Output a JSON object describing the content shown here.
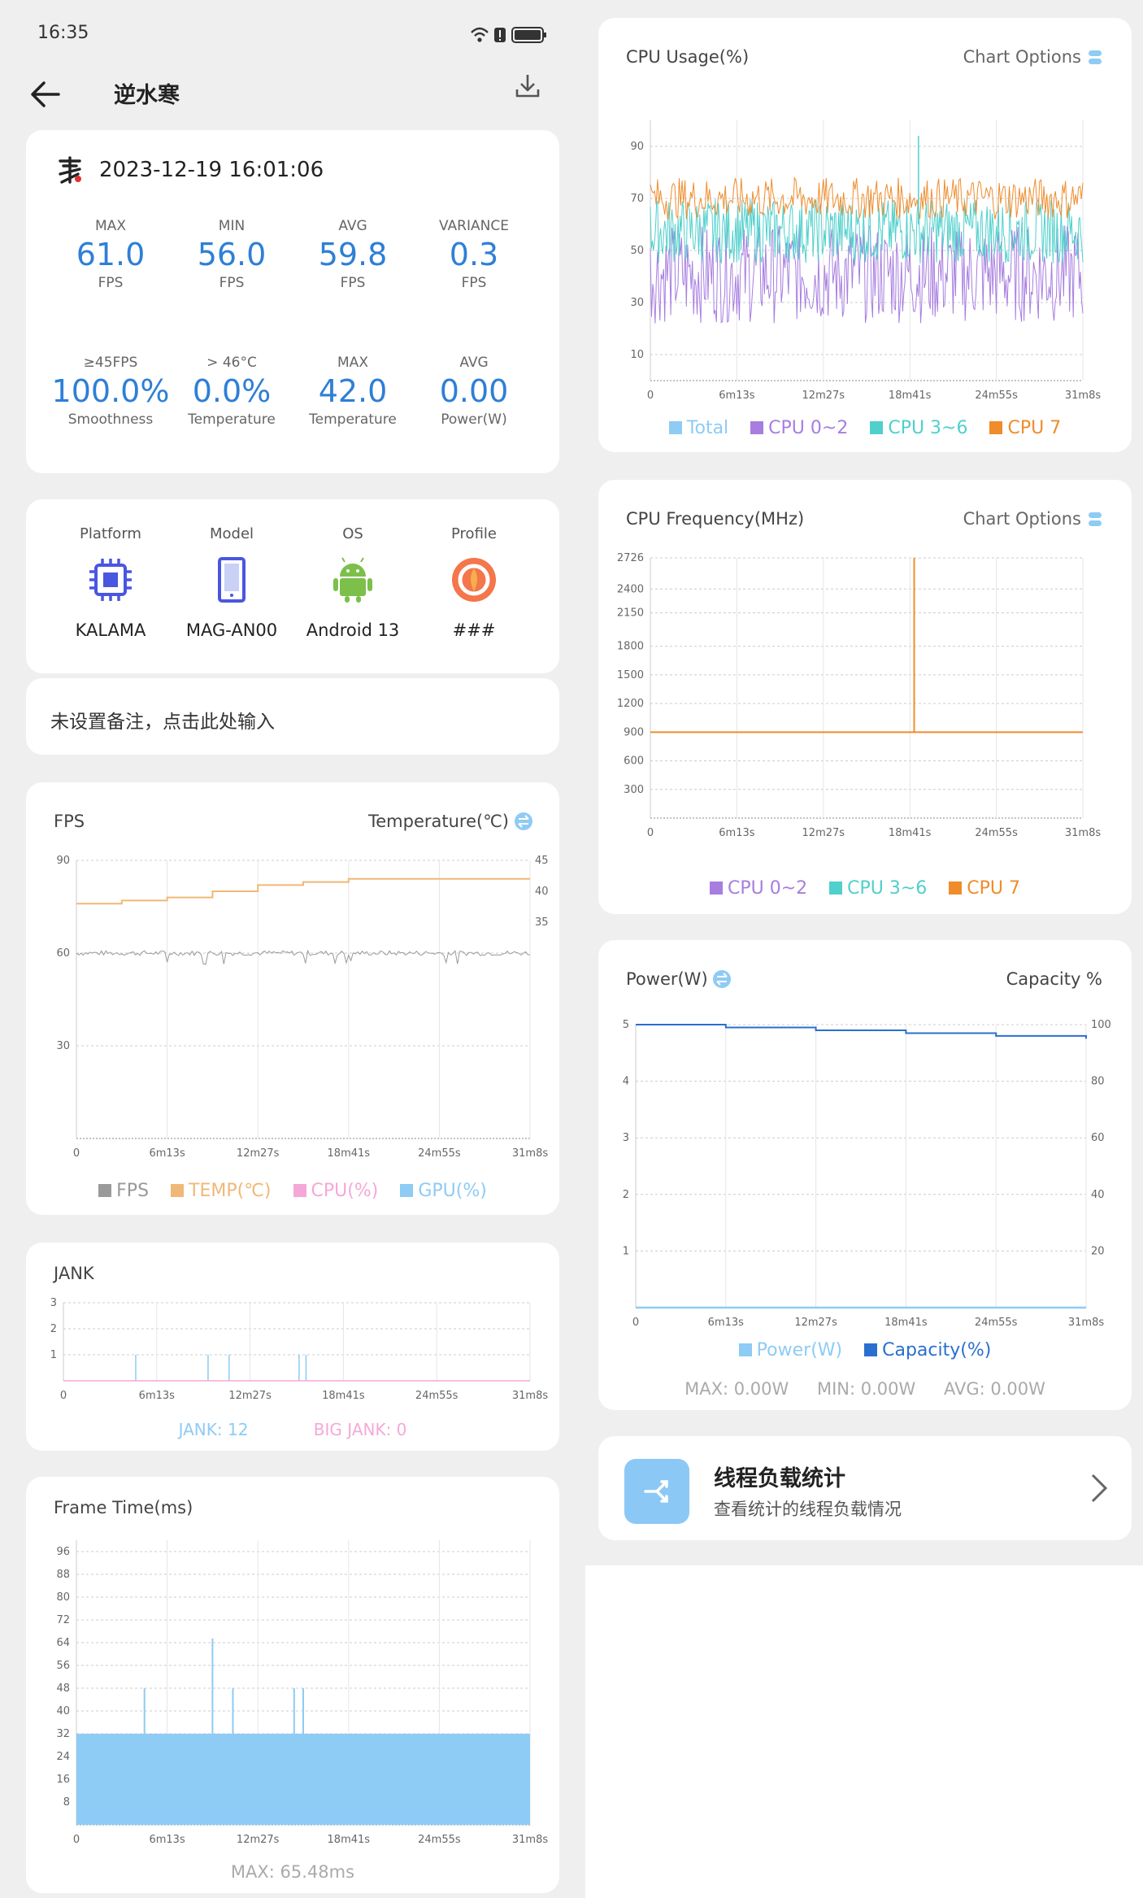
{
  "status": {
    "time": "16:35"
  },
  "header": {
    "title": "逆水寒"
  },
  "summary": {
    "datetime": "2023-12-19 16:01:06",
    "stats": [
      {
        "label": "MAX",
        "value": "61.0",
        "unit": "FPS"
      },
      {
        "label": "MIN",
        "value": "56.0",
        "unit": "FPS"
      },
      {
        "label": "AVG",
        "value": "59.8",
        "unit": "FPS"
      },
      {
        "label": "VARIANCE",
        "value": "0.3",
        "unit": "FPS"
      },
      {
        "label": "≥45FPS",
        "value": "100.0%",
        "unit": "Smoothness"
      },
      {
        "label": "> 46°C",
        "value": "0.0%",
        "unit": "Temperature"
      },
      {
        "label": "MAX",
        "value": "42.0",
        "unit": "Temperature"
      },
      {
        "label": "AVG",
        "value": "0.00",
        "unit": "Power(W)"
      }
    ]
  },
  "device": [
    {
      "label": "Platform",
      "value": "KALAMA",
      "icon": "chip-icon"
    },
    {
      "label": "Model",
      "value": "MAG-AN00",
      "icon": "phone-icon"
    },
    {
      "label": "OS",
      "value": "Android 13",
      "icon": "android-icon"
    },
    {
      "label": "Profile",
      "value": "###",
      "icon": "profile-icon"
    }
  ],
  "note": {
    "placeholder": "未设置备注，点击此处输入"
  },
  "fps_card": {
    "title": "FPS",
    "right": "Temperature(℃)",
    "legend": [
      "FPS",
      "TEMP(℃)",
      "CPU(%)",
      "GPU(%)"
    ]
  },
  "jank_card": {
    "title": "JANK",
    "jank": "JANK: 12",
    "big_jank": "BIG JANK: 0"
  },
  "frame_card": {
    "title": "Frame Time(ms)",
    "max": "MAX: 65.48ms"
  },
  "cpu_usage_card": {
    "title": "CPU Usage(%)",
    "options": "Chart Options",
    "legend": [
      "Total",
      "CPU 0~2",
      "CPU 3~6",
      "CPU 7"
    ]
  },
  "cpu_freq_card": {
    "title": "CPU Frequency(MHz)",
    "options": "Chart Options",
    "legend": [
      "CPU 0~2",
      "CPU 3~6",
      "CPU 7"
    ]
  },
  "power_card": {
    "title": "Power(W)",
    "right": "Capacity %",
    "legend": [
      "Power(W)",
      "Capacity(%)"
    ],
    "stats": [
      "MAX: 0.00W",
      "MIN: 0.00W",
      "AVG: 0.00W"
    ]
  },
  "thread_card": {
    "title": "线程负载统计",
    "subtitle": "查看统计的线程负载情况"
  },
  "colors": {
    "accent": "#2e7fd6",
    "fps": "#9a9a9a",
    "temp": "#f0b878",
    "cpu": "#f5a8d8",
    "gpu": "#8ecbf5",
    "total": "#8ecbf5",
    "cpu02": "#a77de0",
    "cpu36": "#4fd0cc",
    "cpu7": "#ef8c2c",
    "capacity": "#2a6fcf"
  },
  "chart_data": [
    {
      "type": "line",
      "title": "FPS",
      "x_ticks": [
        "0",
        "6m13s",
        "12m27s",
        "18m41s",
        "24m55s",
        "31m8s"
      ],
      "y_ticks": [
        "30",
        "60",
        "90"
      ],
      "y2_ticks": [
        "35",
        "40",
        "45"
      ],
      "ylim": [
        0,
        90
      ],
      "y2lim": [
        0,
        45
      ],
      "series": [
        {
          "name": "FPS",
          "approx_value": 60
        },
        {
          "name": "TEMP(℃)",
          "values": [
            38,
            38.5,
            39,
            40,
            41,
            41.5,
            42,
            42,
            42,
            42,
            42
          ]
        }
      ]
    },
    {
      "type": "bar",
      "title": "JANK",
      "x_ticks": [
        "0",
        "6m13s",
        "12m27s",
        "18m41s",
        "24m55s",
        "31m8s"
      ],
      "y_ticks": [
        "1",
        "2",
        "3"
      ],
      "ylim": [
        0,
        3
      ],
      "jank_positions": [
        0.155,
        0.31,
        0.355,
        0.505,
        0.52
      ],
      "jank_value": 1
    },
    {
      "type": "area",
      "title": "Frame Time(ms)",
      "x_ticks": [
        "0",
        "6m13s",
        "12m27s",
        "18m41s",
        "24m55s",
        "31m8s"
      ],
      "y_ticks": [
        "8",
        "16",
        "24",
        "32",
        "40",
        "48",
        "56",
        "64",
        "72",
        "80",
        "88",
        "96"
      ],
      "ylim": [
        0,
        100
      ],
      "base_value": 32,
      "spikes": [
        {
          "x": 0.15,
          "y": 48
        },
        {
          "x": 0.3,
          "y": 65.48
        },
        {
          "x": 0.345,
          "y": 48
        },
        {
          "x": 0.48,
          "y": 48
        },
        {
          "x": 0.5,
          "y": 48
        }
      ]
    },
    {
      "type": "line",
      "title": "CPU Usage(%)",
      "x_ticks": [
        "0",
        "6m13s",
        "12m27s",
        "18m41s",
        "24m55s",
        "31m8s"
      ],
      "y_ticks": [
        "10",
        "30",
        "50",
        "70",
        "90"
      ],
      "ylim": [
        0,
        100
      ],
      "series": [
        {
          "name": "CPU 7",
          "approx_range": [
            60,
            78
          ]
        },
        {
          "name": "CPU 3~6",
          "approx_range": [
            45,
            70
          ]
        },
        {
          "name": "CPU 0~2",
          "approx_range": [
            22,
            60
          ]
        }
      ]
    },
    {
      "type": "line",
      "title": "CPU Frequency(MHz)",
      "x_ticks": [
        "0",
        "6m13s",
        "12m27s",
        "18m41s",
        "24m55s",
        "31m8s"
      ],
      "y_ticks": [
        "300",
        "600",
        "900",
        "1200",
        "1500",
        "1800",
        "2150",
        "2400",
        "2726"
      ],
      "ylim": [
        0,
        2726
      ],
      "series": [
        {
          "name": "CPU 0~2",
          "approx_range": [
            600,
            2000
          ]
        },
        {
          "name": "CPU 3~6",
          "approx_range": [
            600,
            2400
          ]
        },
        {
          "name": "CPU 7",
          "approx_value": 900,
          "spike": 2726
        }
      ]
    },
    {
      "type": "line",
      "title": "Power(W)",
      "x_ticks": [
        "0",
        "6m13s",
        "12m27s",
        "18m41s",
        "24m55s",
        "31m8s"
      ],
      "y_ticks": [
        "1",
        "2",
        "3",
        "4",
        "5"
      ],
      "y2_ticks": [
        "20",
        "40",
        "60",
        "80",
        "100"
      ],
      "ylim": [
        0,
        5
      ],
      "y2lim": [
        0,
        100
      ],
      "series": [
        {
          "name": "Power(W)",
          "value": 0
        },
        {
          "name": "Capacity(%)",
          "values": [
            100,
            100,
            99,
            99,
            98,
            98,
            97,
            97,
            96,
            96,
            95
          ]
        }
      ]
    }
  ]
}
